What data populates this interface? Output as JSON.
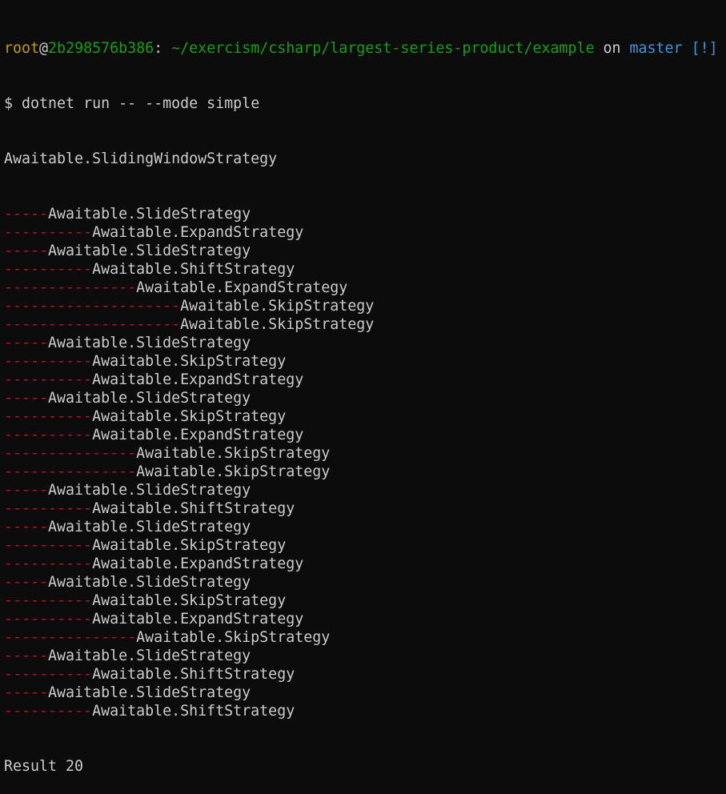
{
  "prompt": {
    "user": "root",
    "at": "@",
    "host": "2b298576b386",
    "sep": ":",
    "path": "~/exercism/csharp/largest-series-product/example",
    "on": "on",
    "branch": "master",
    "status": "[!]"
  },
  "command": {
    "symbol": "$",
    "text": "dotnet run -- --mode simple"
  },
  "output": {
    "root": "Awaitable.SlidingWindowStrategy",
    "lines": [
      {
        "dashes": "-----",
        "text": "Awaitable.SlideStrategy"
      },
      {
        "dashes": "----------",
        "text": "Awaitable.ExpandStrategy"
      },
      {
        "dashes": "-----",
        "text": "Awaitable.SlideStrategy"
      },
      {
        "dashes": "----------",
        "text": "Awaitable.ShiftStrategy"
      },
      {
        "dashes": "---------------",
        "text": "Awaitable.ExpandStrategy"
      },
      {
        "dashes": "--------------------",
        "text": "Awaitable.SkipStrategy"
      },
      {
        "dashes": "--------------------",
        "text": "Awaitable.SkipStrategy"
      },
      {
        "dashes": "-----",
        "text": "Awaitable.SlideStrategy"
      },
      {
        "dashes": "----------",
        "text": "Awaitable.SkipStrategy"
      },
      {
        "dashes": "----------",
        "text": "Awaitable.ExpandStrategy"
      },
      {
        "dashes": "-----",
        "text": "Awaitable.SlideStrategy"
      },
      {
        "dashes": "----------",
        "text": "Awaitable.SkipStrategy"
      },
      {
        "dashes": "----------",
        "text": "Awaitable.ExpandStrategy"
      },
      {
        "dashes": "---------------",
        "text": "Awaitable.SkipStrategy"
      },
      {
        "dashes": "---------------",
        "text": "Awaitable.SkipStrategy"
      },
      {
        "dashes": "-----",
        "text": "Awaitable.SlideStrategy"
      },
      {
        "dashes": "----------",
        "text": "Awaitable.ShiftStrategy"
      },
      {
        "dashes": "-----",
        "text": "Awaitable.SlideStrategy"
      },
      {
        "dashes": "----------",
        "text": "Awaitable.SkipStrategy"
      },
      {
        "dashes": "----------",
        "text": "Awaitable.ExpandStrategy"
      },
      {
        "dashes": "-----",
        "text": "Awaitable.SlideStrategy"
      },
      {
        "dashes": "----------",
        "text": "Awaitable.SkipStrategy"
      },
      {
        "dashes": "----------",
        "text": "Awaitable.ExpandStrategy"
      },
      {
        "dashes": "---------------",
        "text": "Awaitable.SkipStrategy"
      },
      {
        "dashes": "-----",
        "text": "Awaitable.SlideStrategy"
      },
      {
        "dashes": "----------",
        "text": "Awaitable.ShiftStrategy"
      },
      {
        "dashes": "-----",
        "text": "Awaitable.SlideStrategy"
      },
      {
        "dashes": "----------",
        "text": "Awaitable.ShiftStrategy"
      }
    ],
    "result": "Result 20"
  },
  "colors": {
    "background": "#0c0c0c",
    "foreground": "#cccccc",
    "user": "#c19c00",
    "host_path": "#13a10e",
    "branch": "#3a96dd",
    "tree_dash": "#c50f1f"
  }
}
